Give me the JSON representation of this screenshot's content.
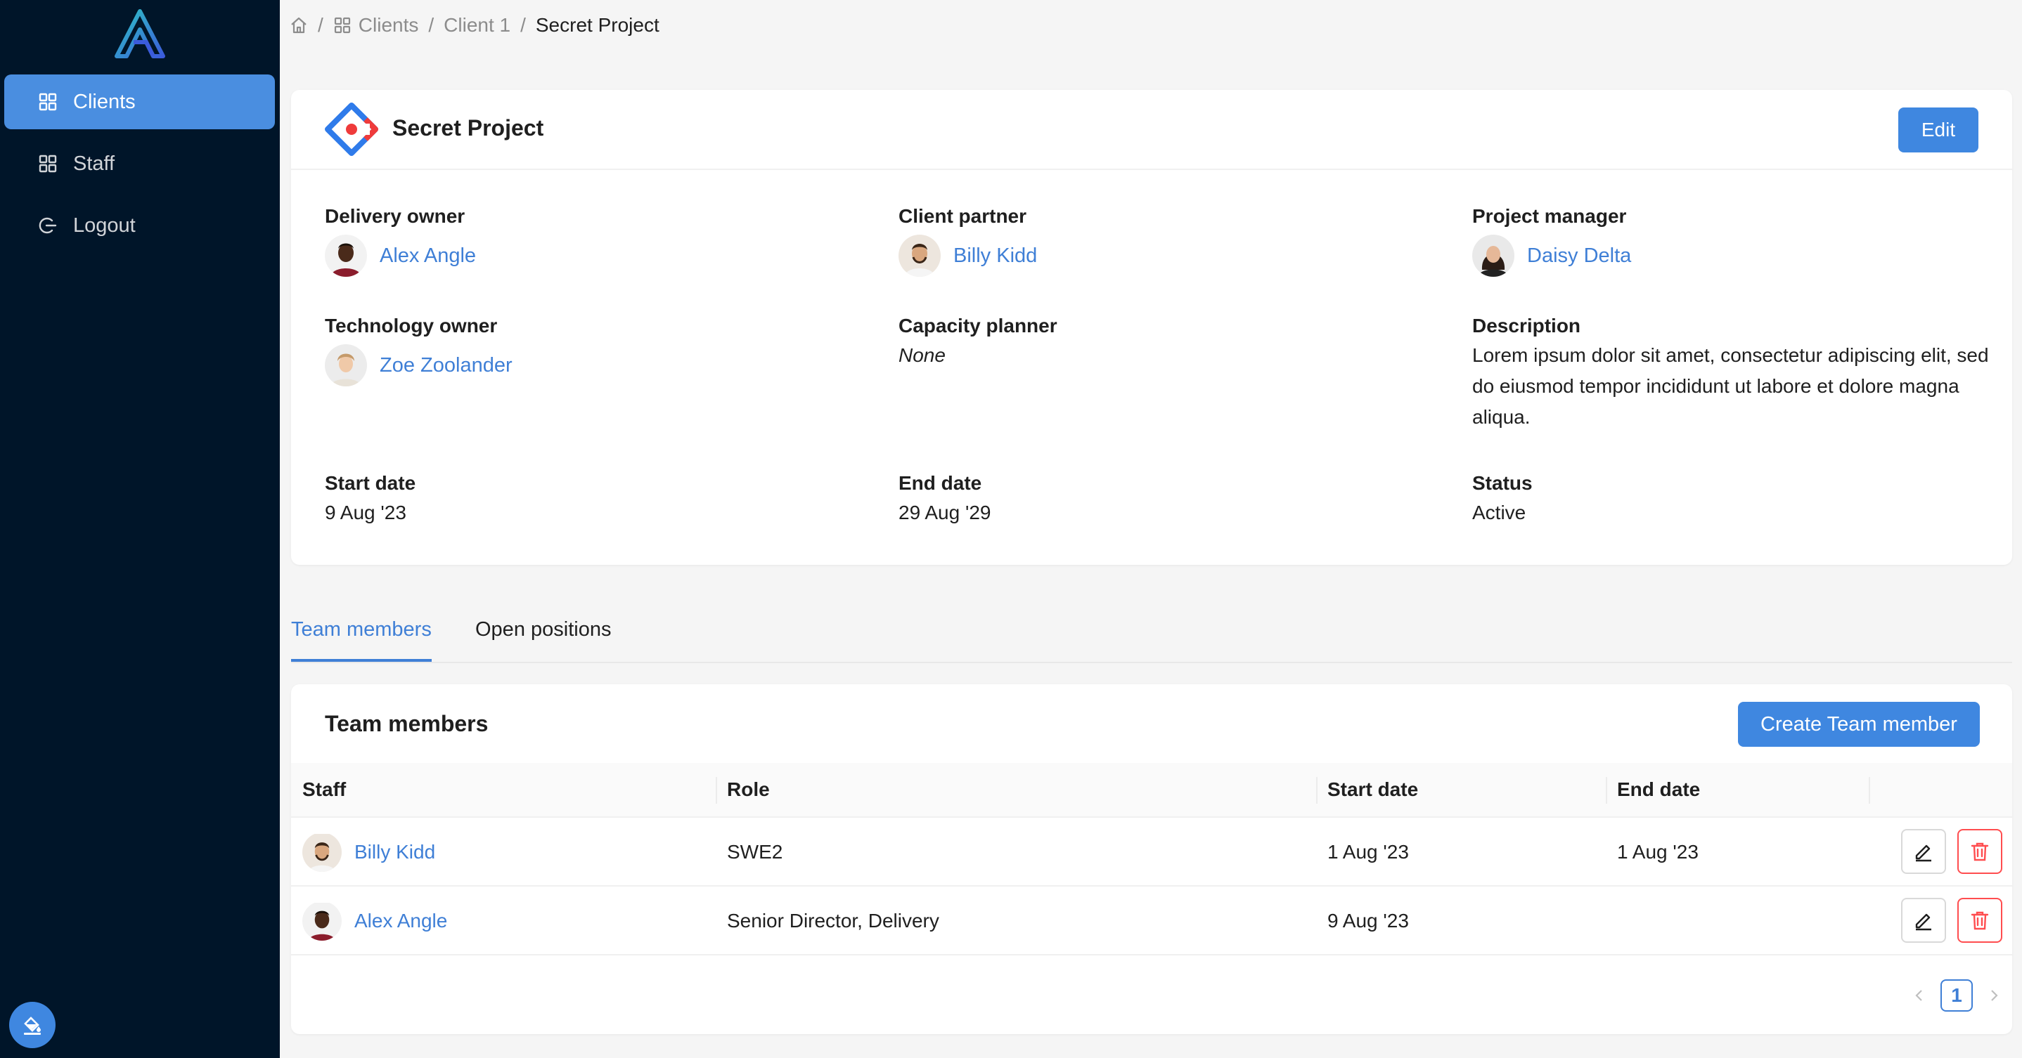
{
  "colors": {
    "sidebar_bg": "#001529",
    "accent": "#3f87e0",
    "link": "#3f7fd6",
    "danger": "#ff4d4f"
  },
  "sidebar": {
    "items": [
      {
        "label": "Clients",
        "icon": "grid-icon",
        "active": true
      },
      {
        "label": "Staff",
        "icon": "grid-icon",
        "active": false
      },
      {
        "label": "Logout",
        "icon": "logout-icon",
        "active": false
      }
    ]
  },
  "breadcrumb": {
    "items": [
      {
        "label": "Clients",
        "icon": "grid-icon"
      },
      {
        "label": "Client 1"
      },
      {
        "label": "Secret Project"
      }
    ],
    "separator": "/"
  },
  "project": {
    "title": "Secret Project",
    "edit_label": "Edit",
    "fields": {
      "delivery_owner": {
        "label": "Delivery owner",
        "value": "Alex Angle"
      },
      "client_partner": {
        "label": "Client partner",
        "value": "Billy Kidd"
      },
      "project_manager": {
        "label": "Project manager",
        "value": "Daisy Delta"
      },
      "technology_owner": {
        "label": "Technology owner",
        "value": "Zoe Zoolander"
      },
      "capacity_planner": {
        "label": "Capacity planner",
        "value": "None"
      },
      "description": {
        "label": "Description",
        "value": "Lorem ipsum dolor sit amet, consectetur adipiscing elit, sed do eiusmod tempor incididunt ut labore et dolore magna aliqua."
      },
      "start_date": {
        "label": "Start date",
        "value": "9 Aug '23"
      },
      "end_date": {
        "label": "End date",
        "value": "29 Aug '29"
      },
      "status": {
        "label": "Status",
        "value": "Active"
      }
    }
  },
  "tabs": [
    {
      "label": "Team members",
      "active": true
    },
    {
      "label": "Open positions",
      "active": false
    }
  ],
  "team": {
    "title": "Team members",
    "create_label": "Create Team member",
    "columns": [
      "Staff",
      "Role",
      "Start date",
      "End date"
    ],
    "rows": [
      {
        "staff": "Billy Kidd",
        "role": "SWE2",
        "start": "1 Aug '23",
        "end": "1 Aug '23"
      },
      {
        "staff": "Alex Angle",
        "role": "Senior Director, Delivery",
        "start": "9 Aug '23",
        "end": ""
      }
    ],
    "pagination": {
      "current_page": "1"
    }
  }
}
